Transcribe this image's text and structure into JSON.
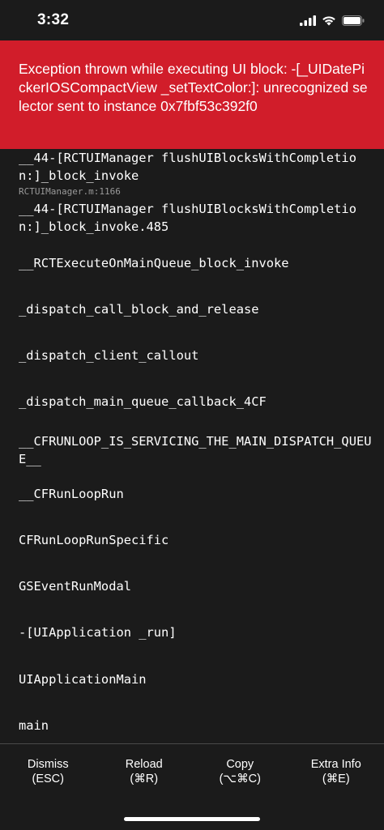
{
  "status_bar": {
    "time": "3:32",
    "icons": [
      "signal-icon",
      "wifi-icon",
      "battery-icon"
    ]
  },
  "error": {
    "message": "Exception thrown while executing UI block: -[_UIDatePickerIOSCompactView _setTextColor:]: unrecognized selector sent to instance 0x7fbf53c392f0",
    "background_color": "#d11d2a"
  },
  "stack": [
    {
      "method": "__44-[RCTUIManager flushUIBlocksWithCompletion:]_block_invoke",
      "file": "RCTUIManager.m:1166"
    },
    {
      "method": "__44-[RCTUIManager flushUIBlocksWithCompletion:]_block_invoke.485",
      "file": ""
    },
    {
      "method": "__RCTExecuteOnMainQueue_block_invoke",
      "file": ""
    },
    {
      "method": "_dispatch_call_block_and_release",
      "file": ""
    },
    {
      "method": "_dispatch_client_callout",
      "file": ""
    },
    {
      "method": "_dispatch_main_queue_callback_4CF",
      "file": ""
    },
    {
      "method": "__CFRUNLOOP_IS_SERVICING_THE_MAIN_DISPATCH_QUEUE__",
      "file": ""
    },
    {
      "method": "__CFRunLoopRun",
      "file": ""
    },
    {
      "method": "CFRunLoopRunSpecific",
      "file": ""
    },
    {
      "method": "GSEventRunModal",
      "file": ""
    },
    {
      "method": "-[UIApplication _run]",
      "file": ""
    },
    {
      "method": "UIApplicationMain",
      "file": ""
    },
    {
      "method": "main",
      "file": ""
    }
  ],
  "footer": {
    "buttons": [
      {
        "label": "Dismiss",
        "shortcut": "(ESC)"
      },
      {
        "label": "Reload",
        "shortcut": "(⌘R)"
      },
      {
        "label": "Copy",
        "shortcut": "(⌥⌘C)"
      },
      {
        "label": "Extra Info",
        "shortcut": "(⌘E)"
      }
    ]
  }
}
